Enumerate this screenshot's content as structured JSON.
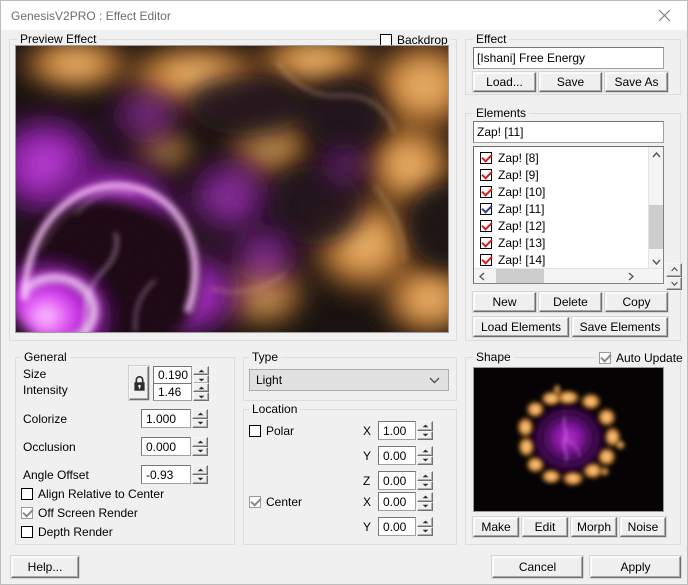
{
  "window": {
    "title": "GenesisV2PRO : Effect Editor",
    "close_icon": "close-icon"
  },
  "preview": {
    "group_label": "Preview Effect",
    "backdrop_label": "Backdrop",
    "backdrop_checked": false
  },
  "effect": {
    "group_label": "Effect",
    "name_value": "[Ishani] Free Energy",
    "load_label": "Load...",
    "save_label": "Save",
    "save_as_label": "Save As"
  },
  "elements": {
    "group_label": "Elements",
    "selected_value": "Zap! [11]",
    "items": [
      {
        "label": "Zap! [8]",
        "checked": true,
        "selected": false
      },
      {
        "label": "Zap! [9]",
        "checked": true,
        "selected": false
      },
      {
        "label": "Zap! [10]",
        "checked": true,
        "selected": false
      },
      {
        "label": "Zap! [11]",
        "checked": true,
        "selected": true
      },
      {
        "label": "Zap! [12]",
        "checked": true,
        "selected": false
      },
      {
        "label": "Zap! [13]",
        "checked": true,
        "selected": false
      },
      {
        "label": "Zap! [14]",
        "checked": true,
        "selected": false
      }
    ],
    "new_label": "New",
    "delete_label": "Delete",
    "copy_label": "Copy",
    "load_elements_label": "Load Elements",
    "save_elements_label": "Save Elements",
    "scroll_up_icon": "chevron-up-icon",
    "scroll_down_icon": "chevron-down-icon",
    "scroll_left_icon": "chevron-left-icon",
    "scroll_right_icon": "chevron-right-icon"
  },
  "general": {
    "group_label": "General",
    "lock_icon": "lock-closed-icon",
    "size_label": "Size",
    "size_value": "0.190",
    "intensity_label": "Intensity",
    "intensity_value": "1.46",
    "colorize_label": "Colorize",
    "colorize_value": "1.000",
    "occlusion_label": "Occlusion",
    "occlusion_value": "0.000",
    "angle_offset_label": "Angle Offset",
    "angle_offset_value": "-0.93",
    "align_label": "Align Relative to Center",
    "align_checked": false,
    "offscreen_label": "Off Screen Render",
    "offscreen_checked": true,
    "depth_label": "Depth Render",
    "depth_checked": false
  },
  "type": {
    "group_label": "Type",
    "selected": "Light",
    "options": [
      "Light"
    ],
    "dropdown_icon": "chevron-down-icon"
  },
  "location": {
    "group_label": "Location",
    "polar_label": "Polar",
    "polar_checked": false,
    "polar_x_label": "X",
    "polar_x_value": "1.00",
    "polar_y_label": "Y",
    "polar_y_value": "0.00",
    "polar_z_label": "Z",
    "polar_z_value": "0.00",
    "center_label": "Center",
    "center_checked": true,
    "center_x_label": "X",
    "center_x_value": "0.00",
    "center_y_label": "Y",
    "center_y_value": "0.00"
  },
  "shape": {
    "group_label": "Shape",
    "auto_update_label": "Auto Update",
    "auto_update_checked": true,
    "make_label": "Make",
    "edit_label": "Edit",
    "morph_label": "Morph",
    "noise_label": "Noise"
  },
  "footer": {
    "help_label": "Help...",
    "cancel_label": "Cancel",
    "apply_label": "Apply"
  },
  "colors": {
    "plasma_purple": "#c01fe0",
    "plasma_orange": "#e8a455",
    "background": "#000000",
    "check_red": "#d81d1d",
    "window_bg": "#f0f0f0"
  }
}
